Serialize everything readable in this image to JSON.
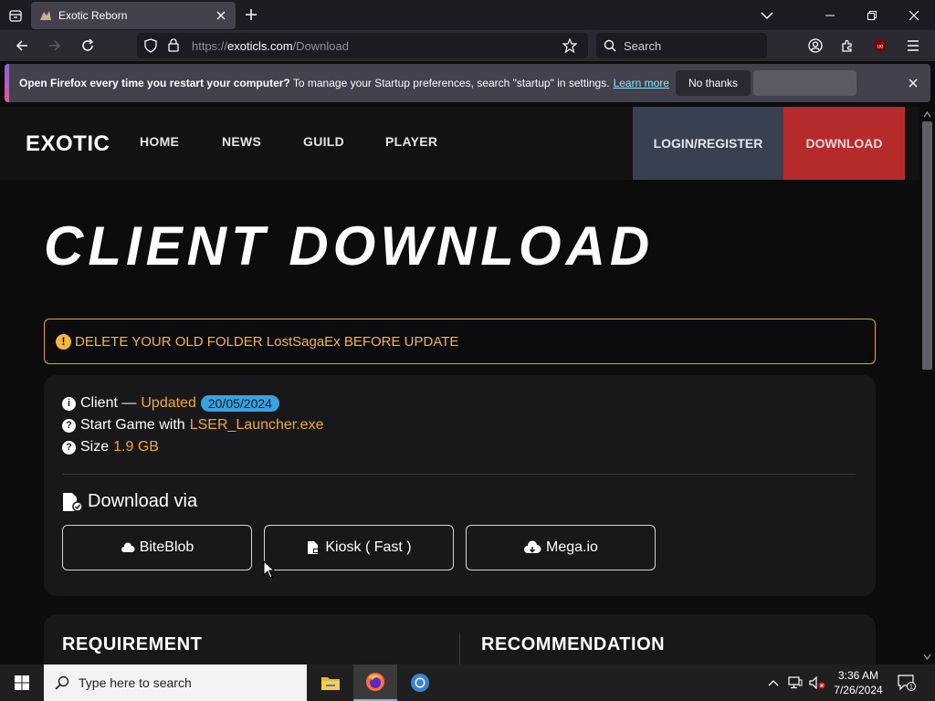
{
  "browser": {
    "tab_title": "Exotic Reborn",
    "url_prefix": "https://",
    "url_host": "exoticls.com",
    "url_path": "/Download",
    "search_placeholder": "Search"
  },
  "notification": {
    "bold_text": "Open Firefox every time you restart your computer?",
    "text": " To manage your Startup preferences, search \"startup\" in settings.",
    "link": "Learn more",
    "button": "No thanks"
  },
  "site": {
    "logo": "EXOTIC",
    "menu": [
      "HOME",
      "NEWS",
      "GUILD",
      "PLAYER"
    ],
    "login": "LOGIN/REGISTER",
    "download": "DOWNLOAD"
  },
  "hero": {
    "title": "CLIENT DOWNLOAD"
  },
  "alert": {
    "text": "DELETE YOUR OLD FOLDER LostSagaEx BEFORE UPDATE"
  },
  "client": {
    "label": "Client —",
    "updated": "Updated",
    "date": "20/05/2024",
    "start_label": "Start Game with",
    "launcher": "LSER_Launcher.exe",
    "size_label": "Size",
    "size": "1.9 GB",
    "download_via": "Download via",
    "mirrors": [
      "BiteBlob",
      "Kiosk ( Fast )",
      "Mega.io"
    ]
  },
  "specs": {
    "requirement": "REQUIREMENT",
    "recommendation": "RECOMMENDATION"
  },
  "taskbar": {
    "search": "Type here to search",
    "time": "3:36 AM",
    "date": "7/26/2024",
    "notif_count": "1"
  },
  "colors": {
    "accent_orange": "#f0a82c",
    "download_red": "#b52b2b",
    "badge_blue": "#38a3e0",
    "login_gray": "#374151"
  }
}
